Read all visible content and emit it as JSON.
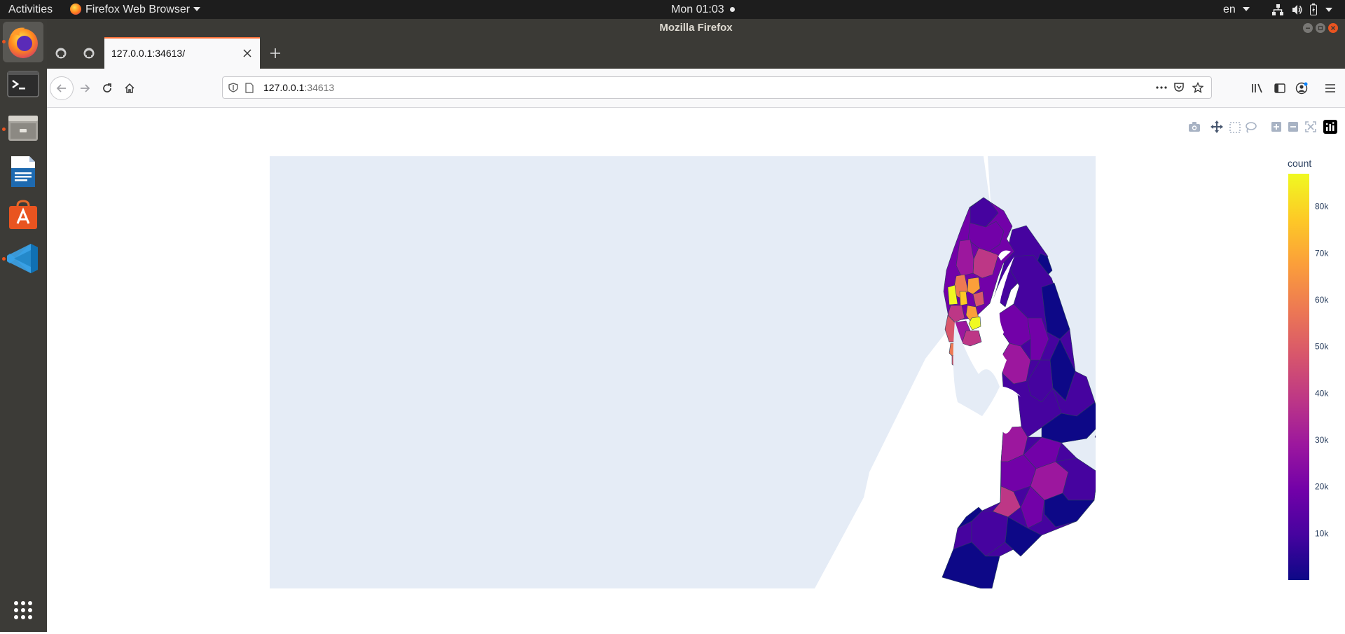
{
  "topbar": {
    "activities": "Activities",
    "app_menu": "Firefox Web Browser",
    "clock": "Mon 01:03",
    "lang": "en"
  },
  "dock": {
    "apps": [
      "firefox-icon",
      "terminal-icon",
      "files-icon",
      "writer-icon",
      "software-center-icon",
      "vscode-icon"
    ],
    "show_apps": "app-grid-icon"
  },
  "window": {
    "title": "Mozilla Firefox"
  },
  "tabs": [
    {
      "label": "127.0.0.1:34613/",
      "active": true
    }
  ],
  "urlbar": {
    "host": "127.0.0.1",
    "port": ":34613"
  },
  "colors": {
    "map_bg": "#e5ecf6",
    "colorscale": [
      "#0d0887",
      "#46039f",
      "#7201a8",
      "#9c179e",
      "#bd3786",
      "#d8576b",
      "#ed7953",
      "#fb9f3a",
      "#fdca26",
      "#f0f921"
    ]
  },
  "chart_data": {
    "type": "choropleth",
    "colorbar": {
      "title": "count",
      "range": [
        0,
        87000
      ],
      "ticks": [
        {
          "value": 10000,
          "label": "10k"
        },
        {
          "value": 20000,
          "label": "20k"
        },
        {
          "value": 30000,
          "label": "30k"
        },
        {
          "value": 40000,
          "label": "40k"
        },
        {
          "value": 50000,
          "label": "50k"
        },
        {
          "value": 60000,
          "label": "60k"
        },
        {
          "value": 70000,
          "label": "70k"
        },
        {
          "value": 80000,
          "label": "80k"
        }
      ]
    },
    "modebar": [
      "camera-icon",
      "pan-icon",
      "box-select-icon",
      "lasso-icon",
      "zoom-in-icon",
      "zoom-out-icon",
      "reset-icon",
      "plotly-logo-icon"
    ]
  }
}
